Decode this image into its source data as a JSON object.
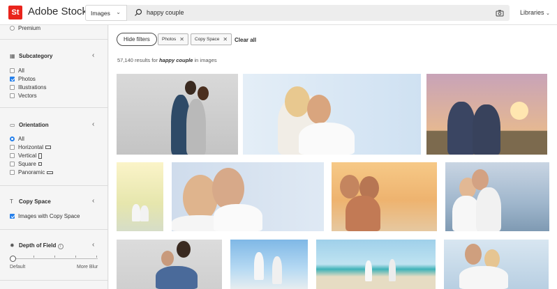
{
  "header": {
    "logo_text": "St",
    "brand": "Adobe Stock",
    "scope": "Images",
    "query": "happy couple",
    "libraries": "Libraries"
  },
  "sidebar": {
    "premium": "Premium",
    "subcategory": {
      "title": "Subcategory",
      "options": [
        {
          "label": "All",
          "checked": false
        },
        {
          "label": "Photos",
          "checked": true
        },
        {
          "label": "Illustrations",
          "checked": false
        },
        {
          "label": "Vectors",
          "checked": false
        }
      ]
    },
    "orientation": {
      "title": "Orientation",
      "options": [
        "All",
        "Horizontal",
        "Vertical",
        "Square",
        "Panoramic"
      ],
      "selected": "All"
    },
    "copy_space": {
      "title": "Copy Space",
      "option": "Images with Copy Space",
      "checked": true
    },
    "depth_of_field": {
      "title": "Depth of Field",
      "min_label": "Default",
      "max_label": "More Blur",
      "value": 0
    }
  },
  "filters": {
    "hide_label": "Hide filters",
    "chips": [
      "Photos",
      "Copy Space"
    ],
    "clear_all": "Clear all"
  },
  "results": {
    "count": "57,140",
    "prefix": "results for",
    "query": "happy couple",
    "suffix": "in images"
  },
  "colors": {
    "accent": "#2680eb",
    "brand": "#e9241c"
  }
}
